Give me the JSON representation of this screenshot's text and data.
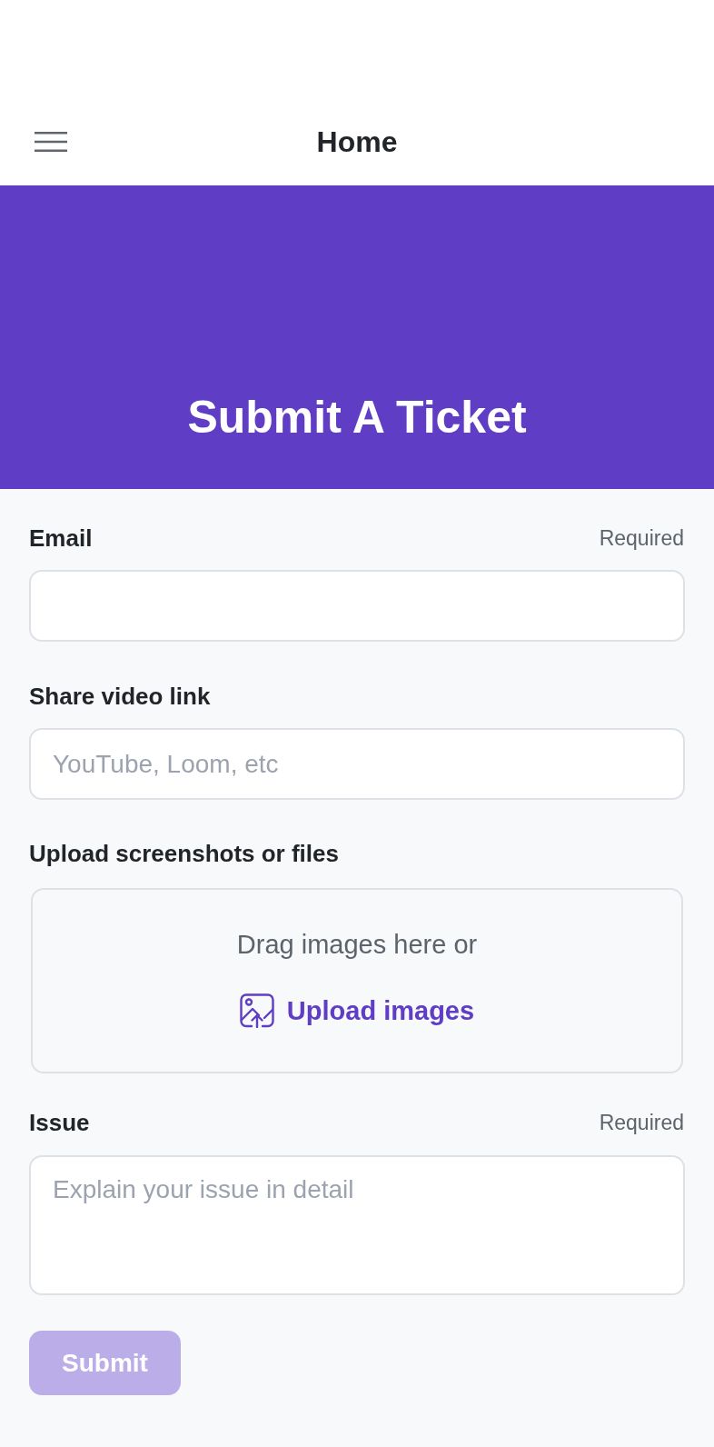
{
  "header": {
    "title": "Home"
  },
  "banner": {
    "title": "Submit A Ticket"
  },
  "fields": [
    {
      "kind": "input",
      "label": "Email",
      "note": "Required"
    },
    {
      "kind": "input",
      "label": "Share video link",
      "placeholder": "YouTube, Loom, etc"
    },
    {
      "kind": "upload",
      "label": "Upload screenshots or files",
      "prompt": "Drag images here or",
      "link": "Upload images"
    },
    {
      "kind": "textarea",
      "label": "Issue",
      "note": "Required",
      "placeholder": "Explain your issue in detail"
    }
  ],
  "submit": {
    "label": "Submit",
    "disabled": true
  }
}
